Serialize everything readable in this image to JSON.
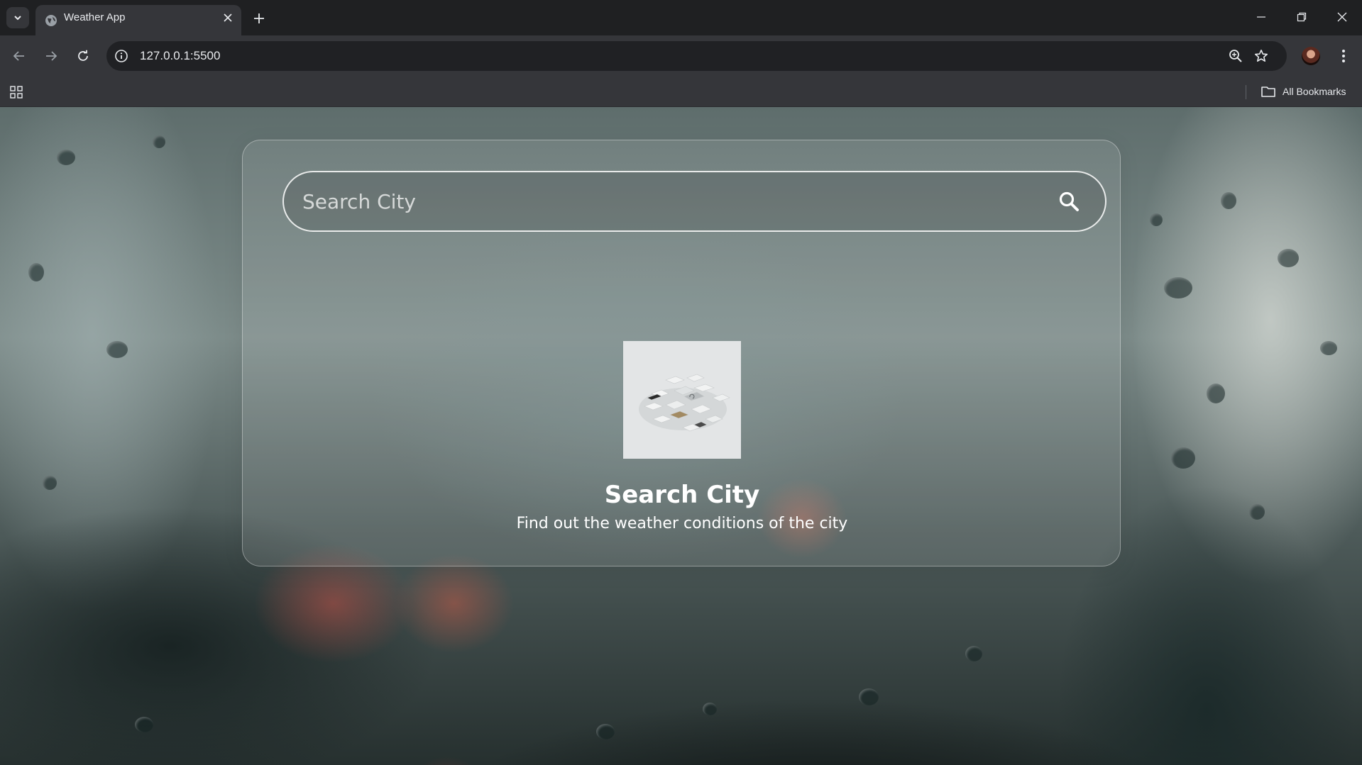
{
  "browser": {
    "tab_title": "Weather App",
    "url": "127.0.0.1:5500",
    "bookmarks_label": "All Bookmarks"
  },
  "icons": {
    "tab_search": "chevron-down-icon",
    "favicon": "globe-icon",
    "tab_close": "close-icon",
    "new_tab": "plus-icon",
    "minimize": "minimize-icon",
    "restore": "restore-icon",
    "window_close": "close-icon",
    "back": "arrow-left-icon",
    "forward": "arrow-right-icon",
    "reload": "reload-icon",
    "site_info": "info-icon",
    "zoom": "zoom-icon",
    "bookmark": "star-icon",
    "menu": "kebab-icon",
    "apps": "apps-grid-icon",
    "folder": "folder-icon",
    "search": "search-icon"
  },
  "app": {
    "search": {
      "placeholder": "Search City",
      "value": ""
    },
    "empty_state": {
      "title": "Search City",
      "subtitle": "Find out the weather conditions of the city"
    }
  }
}
